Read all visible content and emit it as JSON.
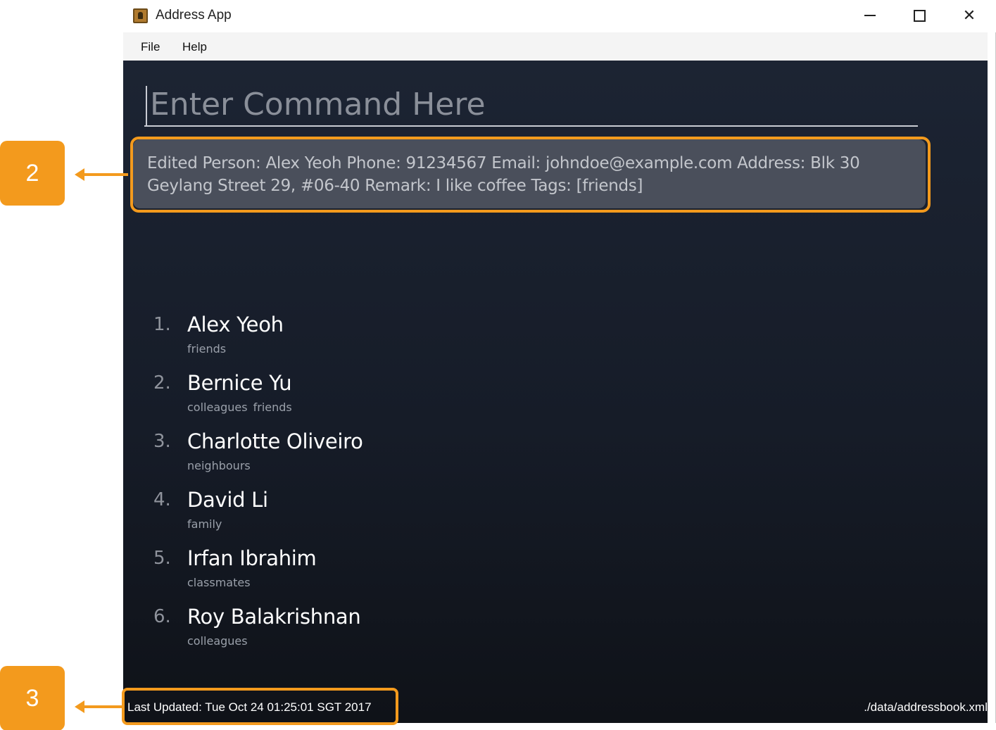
{
  "window": {
    "title": "Address App",
    "accent_color": "#f39a1d"
  },
  "menu": {
    "file": "File",
    "help": "Help"
  },
  "command": {
    "placeholder": "Enter Command Here"
  },
  "result": {
    "text": "Edited Person: Alex Yeoh Phone: 91234567 Email: johndoe@example.com Address: Blk 30 Geylang Street 29, #06-40 Remark: I like coffee Tags: [friends]"
  },
  "persons": [
    {
      "index": "1.",
      "name": "Alex Yeoh",
      "tags": [
        "friends"
      ]
    },
    {
      "index": "2.",
      "name": "Bernice Yu",
      "tags": [
        "colleagues",
        "friends"
      ]
    },
    {
      "index": "3.",
      "name": "Charlotte Oliveiro",
      "tags": [
        "neighbours"
      ]
    },
    {
      "index": "4.",
      "name": "David Li",
      "tags": [
        "family"
      ]
    },
    {
      "index": "5.",
      "name": "Irfan Ibrahim",
      "tags": [
        "classmates"
      ]
    },
    {
      "index": "6.",
      "name": "Roy Balakrishnan",
      "tags": [
        "colleagues"
      ]
    }
  ],
  "status": {
    "last_updated": "Last Updated: Tue Oct 24 01:25:01 SGT 2017",
    "file_path": "./data/addressbook.xml"
  },
  "annotations": {
    "label_2": "2",
    "label_3": "3"
  }
}
